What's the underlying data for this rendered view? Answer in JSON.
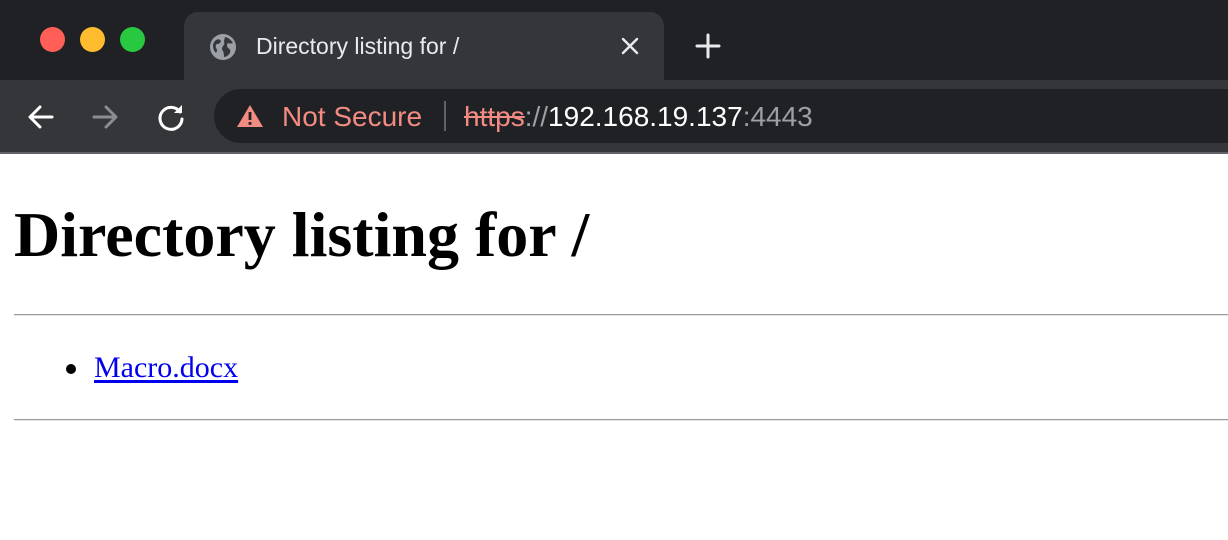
{
  "window": {
    "traffic_lights": [
      "close",
      "minimize",
      "maximize"
    ]
  },
  "tab": {
    "title": "Directory listing for /",
    "icon": "globe-icon"
  },
  "toolbar": {
    "back_icon": "arrow-left-icon",
    "forward_icon": "arrow-right-icon",
    "reload_icon": "reload-icon"
  },
  "omnibox": {
    "security_label": "Not Secure",
    "security_icon": "warning-triangle-icon",
    "url_scheme": "https",
    "url_separator": "://",
    "url_host": "192.168.19.137",
    "url_port": ":4443"
  },
  "page": {
    "heading": "Directory listing for /",
    "files": [
      {
        "name": "Macro.docx"
      }
    ]
  },
  "colors": {
    "tabstrip_bg": "#202124",
    "toolbar_bg": "#35363a",
    "warning": "#f28b82",
    "link": "#0000ee"
  }
}
